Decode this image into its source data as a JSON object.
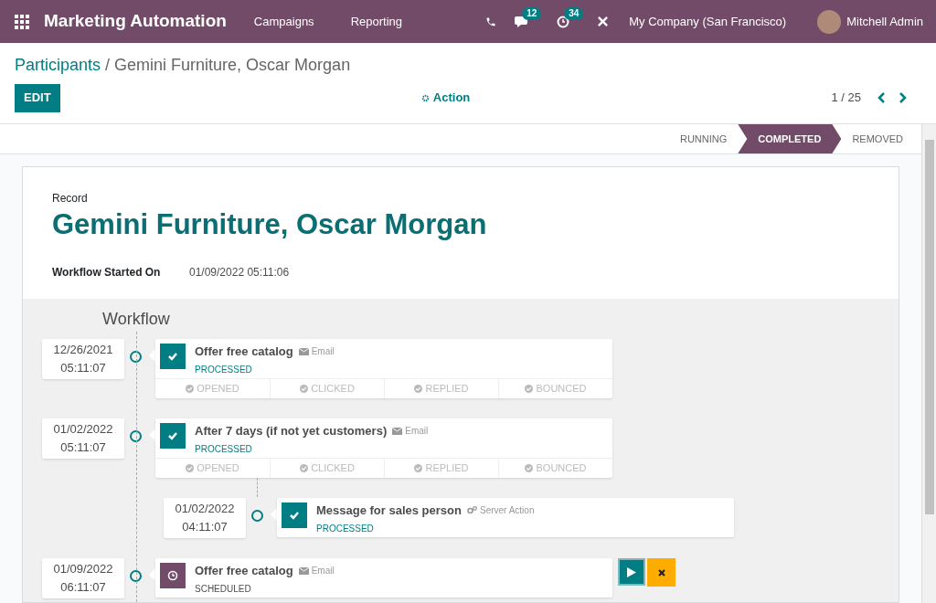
{
  "navbar": {
    "app_name": "Marketing Automation",
    "menu": [
      "Campaigns",
      "Reporting"
    ],
    "messages_count": "12",
    "activities_count": "34",
    "company": "My Company (San Francisco)",
    "user": "Mitchell Admin"
  },
  "breadcrumb": {
    "parent": "Participants",
    "separator": "/",
    "current": "Gemini Furniture, Oscar Morgan"
  },
  "toolbar": {
    "edit": "EDIT",
    "action": "Action",
    "pager": "1 / 25"
  },
  "status_steps": [
    {
      "label": "RUNNING",
      "selected": false
    },
    {
      "label": "COMPLETED",
      "selected": true
    },
    {
      "label": "REMOVED",
      "selected": false
    }
  ],
  "record": {
    "label": "Record",
    "name": "Gemini Furniture, Oscar Morgan",
    "started_label": "Workflow Started On",
    "started_value": "01/09/2022 05:11:06"
  },
  "workflow": {
    "title": "Workflow",
    "activities": [
      {
        "date": "12/26/2021",
        "time": "05:11:07",
        "name": "Offer free catalog",
        "kind": "email",
        "type_label": "Email",
        "processed": true,
        "state_label": "PROCESSED",
        "stats": [
          "OPENED",
          "CLICKED",
          "REPLIED",
          "BOUNCED"
        ]
      },
      {
        "date": "01/02/2022",
        "time": "05:11:07",
        "name": "After 7 days (if not yet customers)",
        "kind": "email",
        "type_label": "Email",
        "processed": true,
        "state_label": "PROCESSED",
        "stats": [
          "OPENED",
          "CLICKED",
          "REPLIED",
          "BOUNCED"
        ],
        "children": [
          {
            "date": "01/02/2022",
            "time": "04:11:07",
            "name": "Message for sales person",
            "kind": "server_action",
            "type_label": "Server Action",
            "processed": true,
            "state_label": "PROCESSED"
          }
        ]
      },
      {
        "date": "01/09/2022",
        "time": "06:11:07",
        "name": "Offer free catalog",
        "kind": "email",
        "type_label": "Email",
        "processed": false,
        "state_label": "SCHEDULED"
      }
    ]
  }
}
